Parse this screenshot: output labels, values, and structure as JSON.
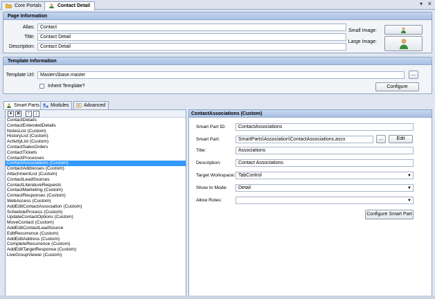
{
  "doc_tabs": [
    {
      "label": "Core Portals"
    },
    {
      "label": "Contact Detail"
    }
  ],
  "page_info": {
    "header": "Page Information",
    "alias_label": "Alias:",
    "alias_value": "Contact",
    "title_label": "Title:",
    "title_value": "Contact Detail",
    "description_label": "Description:",
    "description_value": "Contact Detail",
    "small_image_label": "Small Image:",
    "large_image_label": "Large Image:"
  },
  "template_info": {
    "header": "Template Information",
    "url_label": "Template Url:",
    "url_value": "Masters\\base.master",
    "browse_label": "...",
    "inherit_label": "Inherit Template?",
    "configure_label": "Configure"
  },
  "bottom_tabs": [
    {
      "label": "Smart Parts"
    },
    {
      "label": "Modules"
    },
    {
      "label": "Advanced"
    }
  ],
  "smart_parts": [
    "ContactDetails",
    "ContactExtendedDetails",
    "NotesList (Custom)",
    "HistoryList (Custom)",
    "ActivityList (Custom)",
    "ContactSalesOrders",
    "ContactTickets",
    "ContactProcesses",
    "ContactAssociations (Custom)",
    "ContactAddresses (Custom)",
    "AttachmentList (Custom)",
    "ContactLeadSources",
    "ContactLiteratureRequests",
    "ContactMarketing (Custom)",
    "ContactResponses (Custom)",
    "WebAccess (Custom)",
    "AddEditContactAssociation (Custom)",
    "ScheduleProcess (Custom)",
    "UpdateContactOptions (Custom)",
    "MoveContact (Custom)",
    "AddEditContactLeadSource",
    "EditRecurrence (Custom)",
    "AddEditAddress (Custom)",
    "CompleteRecurrence (Custom)",
    "AddEditTargetResponse (Custom)",
    "LiveGroupViewer (Custom)"
  ],
  "selected_index": 8,
  "detail": {
    "header": "ContactAssociations (Custom)",
    "id_label": "Smart Part ID:",
    "id_value": "ContactAssociations",
    "part_label": "Smart Part:",
    "part_value": "SmartParts\\Association\\ContactAssociations.ascx",
    "browse_label": "...",
    "edit_label": "Edit",
    "title_label": "Title:",
    "title_value": "Associations",
    "description_label": "Description:",
    "description_value": "Contact Associations",
    "workspace_label": "Target Workspace:",
    "workspace_value": "TabControl",
    "mode_label": "Show In Mode:",
    "mode_value": "Detail",
    "roles_label": "Allow Roles:",
    "roles_value": "",
    "configure_label": "Configure Smart Part"
  },
  "colors": {
    "accent": "#3399ff",
    "header_gradient_top": "#c5d6ee",
    "border": "#8ea4c4"
  }
}
